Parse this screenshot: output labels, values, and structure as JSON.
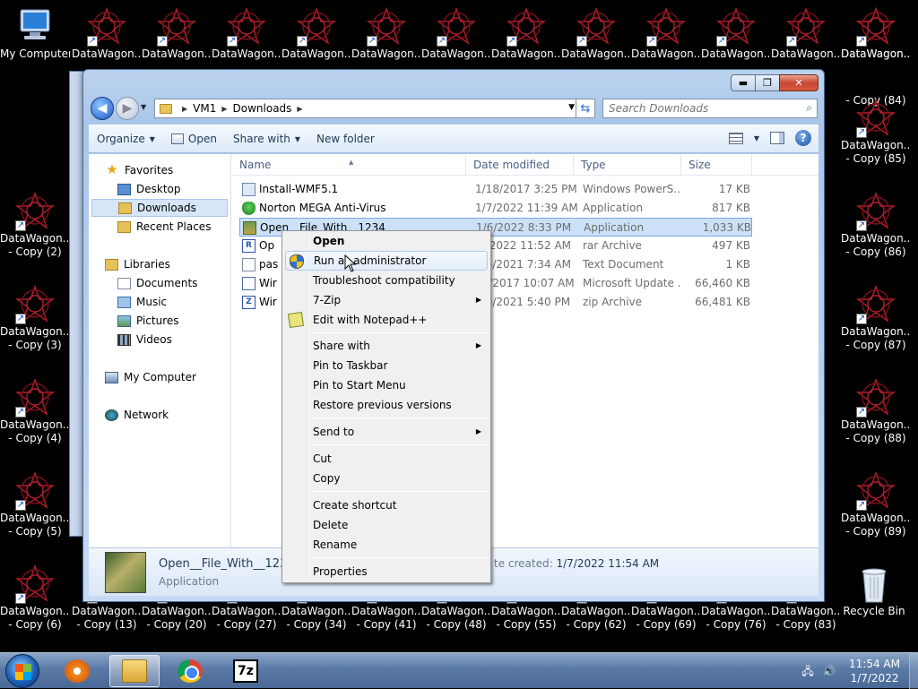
{
  "desktop": {
    "icons": [
      {
        "label": "My Computer"
      },
      {
        "label": "DataWagon...."
      },
      {
        "label": "DataWagon...."
      },
      {
        "label": "DataWagon...."
      },
      {
        "label": "DataWagon...."
      },
      {
        "label": "DataWagon...."
      },
      {
        "label": "DataWagon...."
      },
      {
        "label": "DataWagon...."
      },
      {
        "label": "DataWagon...."
      },
      {
        "label": "DataWagon...."
      },
      {
        "label": "DataWagon...."
      },
      {
        "label": "DataWagon...."
      },
      {
        "label": "DataWagon...."
      },
      {
        "label": "DataWagon..."
      },
      {
        "label": "DataWagon...",
        "sub": "- Copy (2)"
      },
      {
        "label": "DataWagon...",
        "sub": "- Copy (3)"
      },
      {
        "label": "DataWagon...",
        "sub": "- Copy (4)"
      },
      {
        "label": "DataWagon...",
        "sub": "- Copy (5)"
      },
      {
        "label": "DataWagon...",
        "sub": "- Copy (6)"
      },
      {
        "label": "DataWagon...",
        "sub": "- Copy (13)"
      },
      {
        "label": "DataWagon...",
        "sub": "- Copy (20)"
      },
      {
        "label": "DataWagon...",
        "sub": "- Copy (27)"
      },
      {
        "label": "DataWagon...",
        "sub": "- Copy (34)"
      },
      {
        "label": "DataWagon...",
        "sub": "- Copy (41)"
      },
      {
        "label": "DataWagon...",
        "sub": "- Copy (48)"
      },
      {
        "label": "DataWagon...",
        "sub": "- Copy (55)"
      },
      {
        "label": "DataWagon...",
        "sub": "- Copy (62)"
      },
      {
        "label": "DataWagon...",
        "sub": "- Copy (69)"
      },
      {
        "label": "DataWagon...",
        "sub": "- Copy (76)"
      },
      {
        "label": "DataWagon...",
        "sub": "- Copy (83)"
      },
      {
        "label": "Recycle Bin"
      },
      {
        "label": "",
        "sub": "- Copy (84)"
      },
      {
        "label": "DataWagon...",
        "sub": "- Copy (85)"
      },
      {
        "label": "DataWagon...",
        "sub": "- Copy (86)"
      },
      {
        "label": "DataWagon...",
        "sub": "- Copy (87)"
      },
      {
        "label": "DataWagon...",
        "sub": "- Copy (88)"
      },
      {
        "label": "DataWagon...",
        "sub": "- Copy (89)"
      }
    ]
  },
  "explorer": {
    "address": {
      "root": "VM1",
      "current": "Downloads"
    },
    "search_placeholder": "Search Downloads",
    "toolbar": {
      "organize": "Organize",
      "open": "Open",
      "share_with": "Share with",
      "new_folder": "New folder"
    },
    "nav": {
      "favorites": "Favorites",
      "desktop": "Desktop",
      "downloads": "Downloads",
      "recent": "Recent Places",
      "libraries": "Libraries",
      "documents": "Documents",
      "music": "Music",
      "pictures": "Pictures",
      "videos": "Videos",
      "computer": "My Computer",
      "network": "Network"
    },
    "columns": {
      "name": "Name",
      "date": "Date modified",
      "type": "Type",
      "size": "Size"
    },
    "files": [
      {
        "name": "Install-WMF5.1",
        "date": "1/18/2017 3:25 PM",
        "type": "Windows PowerS...",
        "size": "17 KB",
        "icon": "powershell-icon"
      },
      {
        "name": "Norton MEGA Anti-Virus",
        "date": "1/7/2022 11:39 AM",
        "type": "Application",
        "size": "817 KB",
        "icon": "shield-icon"
      },
      {
        "name": "Open__File_With__1234",
        "date": "1/6/2022 8:33 PM",
        "type": "Application",
        "size": "1,033 KB",
        "icon": "app-icon"
      },
      {
        "name": "Op",
        "date": "/7/2022 11:52 AM",
        "type": "rar Archive",
        "size": "497 KB",
        "icon": "rar-icon"
      },
      {
        "name": "pas",
        "date": "/16/2021 7:34 AM",
        "type": "Text Document",
        "size": "1 KB",
        "icon": "text-icon"
      },
      {
        "name": "Wir",
        "date": "13/2017 10:07 AM",
        "type": "Microsoft Update ...",
        "size": "66,460 KB",
        "icon": "msu-icon"
      },
      {
        "name": "Wir",
        "date": "/30/2021 5:40 PM",
        "type": "zip Archive",
        "size": "66,481 KB",
        "icon": "zip-icon"
      }
    ],
    "details": {
      "name": "Open__File_With__1234",
      "type": "Application",
      "created_label": "te created:",
      "created_value": "1/7/2022 11:54 AM"
    }
  },
  "context_menu": {
    "open": "Open",
    "run_admin": "Run as administrator",
    "troubleshoot": "Troubleshoot compatibility",
    "sevenzip": "7-Zip",
    "notepad": "Edit with Notepad++",
    "share_with": "Share with",
    "pin_taskbar": "Pin to Taskbar",
    "pin_start": "Pin to Start Menu",
    "restore": "Restore previous versions",
    "send_to": "Send to",
    "cut": "Cut",
    "copy": "Copy",
    "create_shortcut": "Create shortcut",
    "delete": "Delete",
    "rename": "Rename",
    "properties": "Properties"
  },
  "taskbar": {
    "sevenzip_label": "7z",
    "clock_time": "11:54 AM",
    "clock_date": "1/7/2022"
  }
}
